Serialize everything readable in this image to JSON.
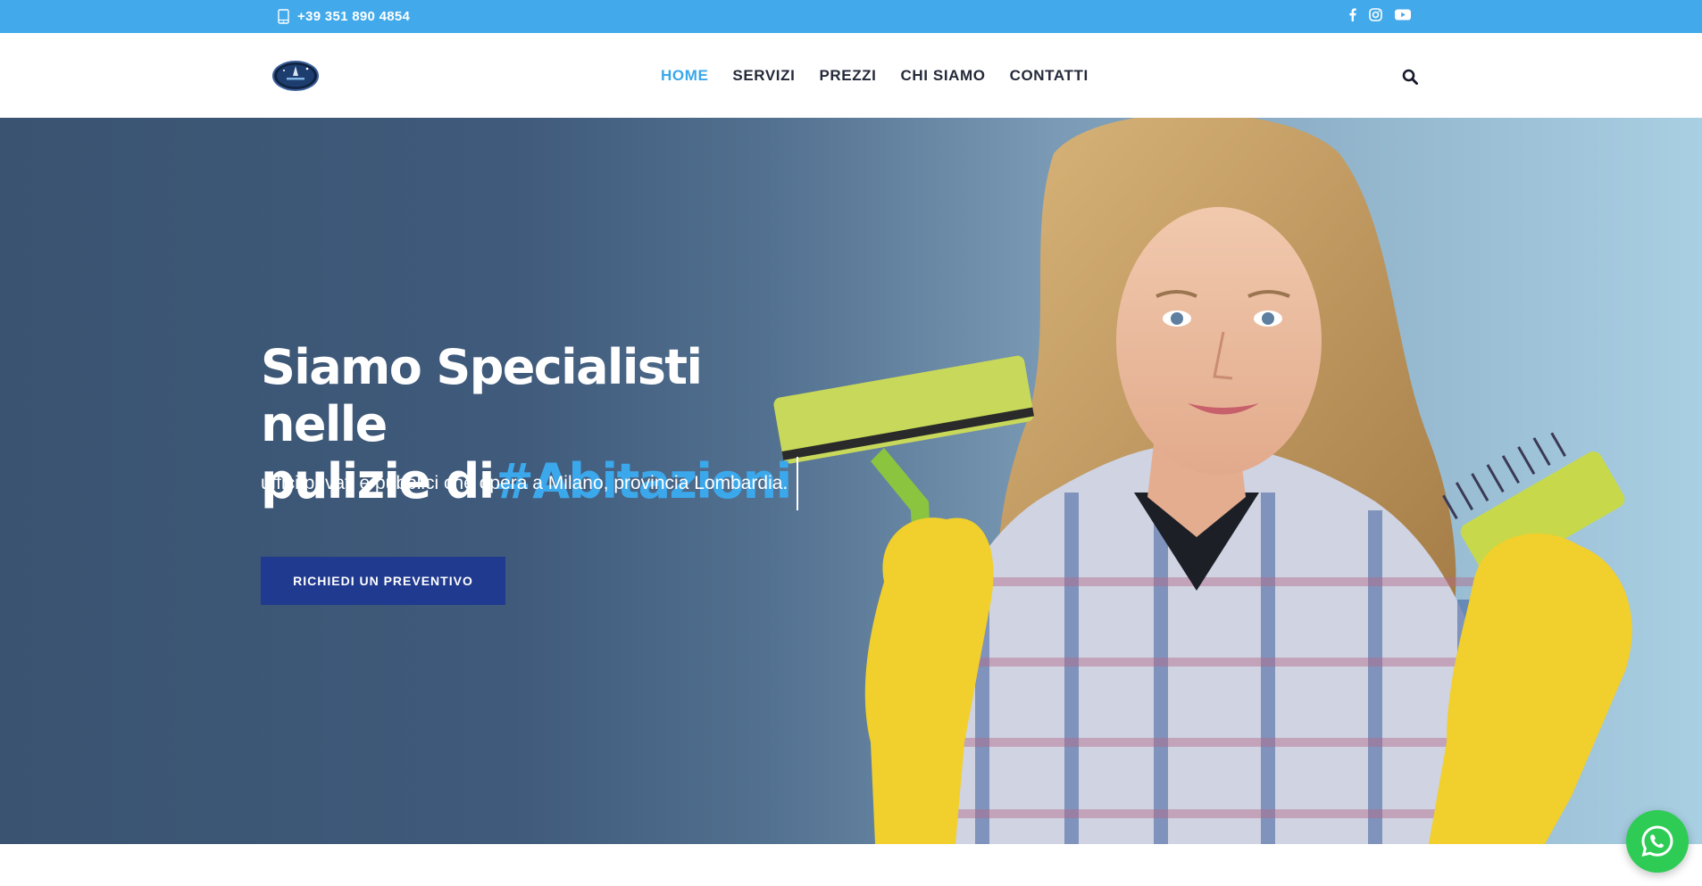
{
  "topbar": {
    "phone": "+39 351 890 4854",
    "phone_icon": "mobile-phone-icon",
    "socials": [
      "facebook-icon",
      "instagram-icon",
      "youtube-icon"
    ]
  },
  "header": {
    "logo": "company-logo",
    "nav": [
      {
        "label": "HOME",
        "active": true
      },
      {
        "label": "SERVIZI",
        "active": false
      },
      {
        "label": "PREZZI",
        "active": false
      },
      {
        "label": "CHI SIAMO",
        "active": false
      },
      {
        "label": "CONTATTI",
        "active": false
      }
    ],
    "search_icon": "search-icon"
  },
  "hero": {
    "title_line1": "Siamo Specialisti nelle",
    "title_line2_prefix": "pulizie di",
    "title_highlight": "#Abitazioni",
    "subtitle": "uffici privati e pubblici che opera a Milano, provincia Lombardia.",
    "cta_label": "RICHIEDI UN PREVENTIVO"
  },
  "floating": {
    "whatsapp_icon": "whatsapp-icon"
  },
  "colors": {
    "topbar": "#42a9ea",
    "accent": "#3ca8ec",
    "cta": "#203a8f",
    "nav_text": "#252a3a",
    "whatsapp": "#2ecc55"
  }
}
